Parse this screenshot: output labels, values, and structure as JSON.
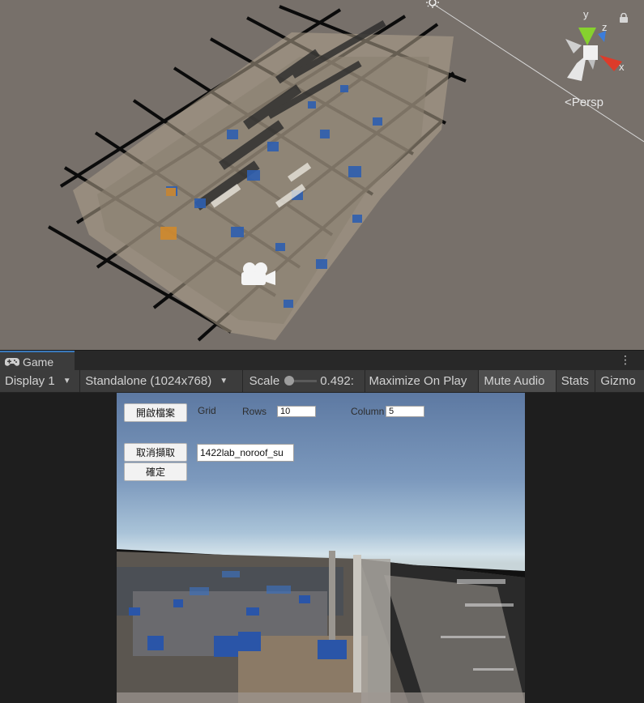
{
  "scene": {
    "gizmo_axes": {
      "y": "y",
      "z": "z",
      "x": "x"
    },
    "projection_label": "Persp",
    "icons": [
      "lock-icon",
      "sun-icon",
      "camera-icon"
    ]
  },
  "game_panel": {
    "tab_label": "Game",
    "tab_icon": "gamepad-icon",
    "menu_icon": "⋮"
  },
  "toolbar": {
    "display": "Display 1",
    "resolution": "Standalone (1024x768)",
    "scale_label": "Scale",
    "scale_value": "0.492:",
    "scale_fraction": 0.0,
    "maximize": "Maximize On Play",
    "mute": "Mute Audio",
    "stats": "Stats",
    "gizmos": "Gizmo"
  },
  "game_ui": {
    "open_file_button": "開啟檔案",
    "grid_label": "Grid",
    "rows_label": "Rows",
    "rows_value": "10",
    "column_label": "Column",
    "column_value": "5",
    "cancel_button": "取消擷取",
    "filename_value": "1422lab_noroof_su",
    "confirm_button": "確定"
  },
  "colors": {
    "scene_bg": "#77706a",
    "toolbar_bg": "#3c3c3c",
    "tab_accent": "#3a79bb",
    "sky_top": "#5d79a2",
    "horizon": "#d3e2ea",
    "gizmo_y": "#86d12e",
    "gizmo_z": "#3c7ddb",
    "gizmo_x": "#dd3b2a"
  }
}
